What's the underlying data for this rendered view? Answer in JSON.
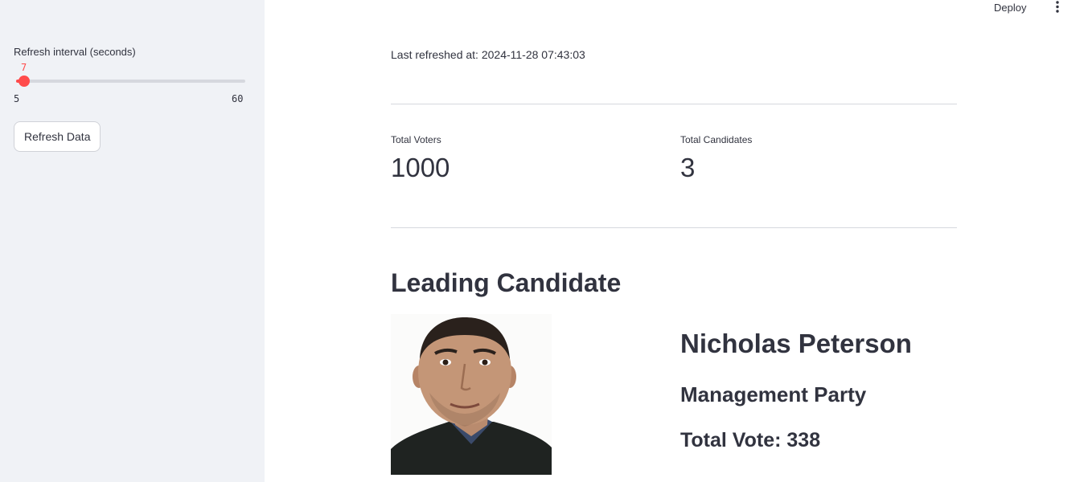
{
  "header": {
    "deploy_label": "Deploy",
    "menu_icon": "vertical-ellipsis-icon"
  },
  "sidebar": {
    "slider": {
      "label": "Refresh interval (seconds)",
      "value": 7,
      "min": 5,
      "max": 60,
      "color": "#ff4b4b"
    },
    "refresh_button_label": "Refresh Data"
  },
  "main": {
    "last_refreshed": "Last refreshed at: 2024-11-28 07:43:03",
    "metrics": [
      {
        "label": "Total Voters",
        "value": "1000"
      },
      {
        "label": "Total Candidates",
        "value": "3"
      }
    ],
    "leading_heading": "Leading Candidate",
    "leading": {
      "name": "Nicholas Peterson",
      "party": "Management Party",
      "total_vote": "Total Vote: 338"
    }
  }
}
